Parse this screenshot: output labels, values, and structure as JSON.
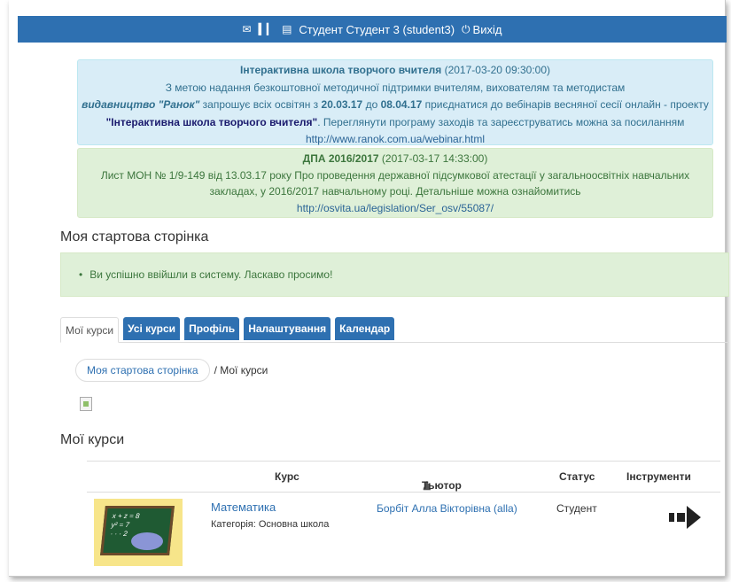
{
  "topbar": {
    "user": "Студент Студент 3 (student3)",
    "logout": "Вихід",
    "icons": [
      "mail-icon",
      "stats-icon",
      "user-card-icon",
      "power-icon"
    ],
    "bg_color": "#2e70b1"
  },
  "news": [
    {
      "title": "Інтерактивна школа творчого вчителя",
      "date": "(2017-03-20 09:30:00)",
      "line1": "З метою надання безкоштовної методичної підтримки вчителям, вихователям та методистам",
      "publisher": "видавництво \"Ранок\"",
      "t1": " запрошує всіх освітян з ",
      "d1": "20.03.17",
      "t2": " до ",
      "d2": "08.04.17",
      "t3": " приєднатися до вебінарів весняної сесії онлайн - проекту ",
      "project": "\"Інтерактивна школа творчого вчителя\"",
      "t4": ". Переглянути програму заходів та зареєструватись можна за посиланням ",
      "link": "http://www.ranok.com.ua/webinar.html"
    },
    {
      "title": "ДПА 2016/2017",
      "date": "(2017-03-17 14:33:00)",
      "body": "Лист МОН № 1/9-149 від 13.03.17 року Про проведення державної підсумкової атестації у загальноосвітніх навчальних закладах, у 2016/2017 навчальному році. Детальніше можна ознайомитись",
      "link": "http://osvita.ua/legislation/Ser_osv/55087/"
    }
  ],
  "start_heading": "Моя стартова сторінка",
  "welcome": "Ви успішно ввійшли в систему. Ласкаво просимо!",
  "tabs": [
    {
      "label": "Мої курси",
      "active": true
    },
    {
      "label": "Усі курси",
      "active": false
    },
    {
      "label": "Профіль",
      "active": false
    },
    {
      "label": "Налаштування",
      "active": false
    },
    {
      "label": "Календар",
      "active": false
    }
  ],
  "breadcrumb": {
    "home": "Моя стартова сторінка",
    "current": "/ Мої курси"
  },
  "courses_heading": "Мої курси",
  "table": {
    "headers": {
      "course": "Курс",
      "tutor": "Тьютор",
      "status": "Статус",
      "tools": "Інструменти"
    },
    "rows": [
      {
        "name": "Математика",
        "category": "Категорія: Основна школа",
        "tutor": "Борбіт Алла Вікторівна (alla)",
        "status": "Студент",
        "tool_icon": "enter-arrow-icon"
      }
    ]
  }
}
